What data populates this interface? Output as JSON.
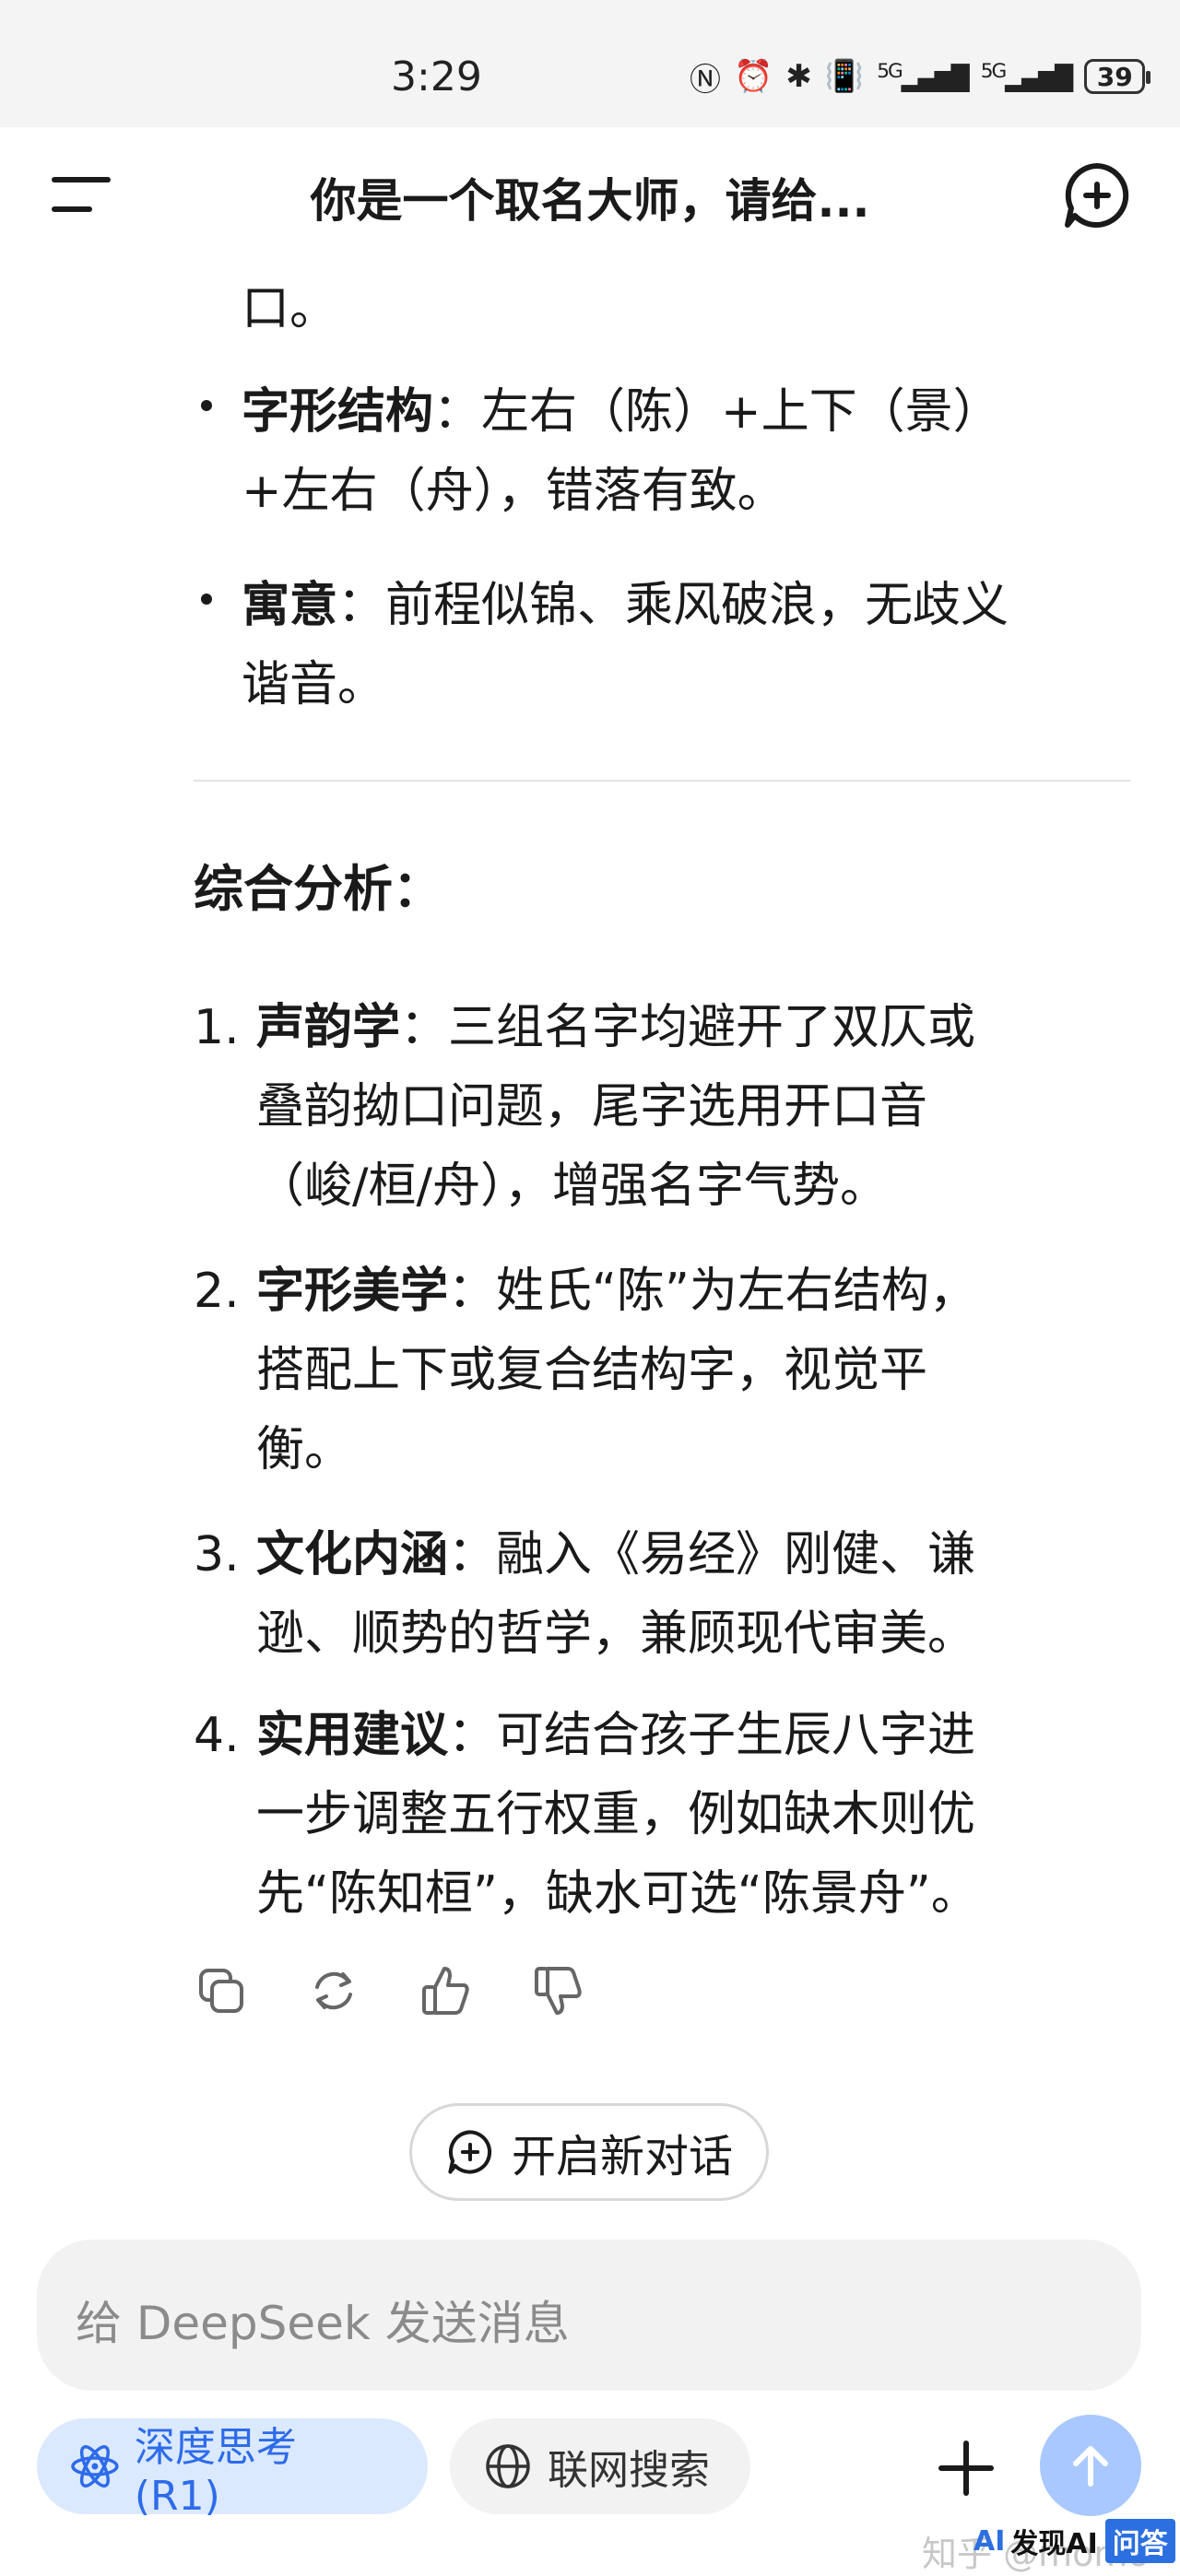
{
  "status_bar": {
    "time": "3:29",
    "network_1": "5G",
    "network_2": "5G",
    "battery": "39"
  },
  "header": {
    "title": "你是一个取名大师，请给..."
  },
  "message": {
    "continued_tail": "口。",
    "bullets": [
      {
        "label": "字形结构",
        "sep": "：",
        "line1": "左右（陈）+上下（景）",
        "line2": "+左右（舟），错落有致。"
      },
      {
        "label": "寓意",
        "sep": "：",
        "line1": "前程似锦、乘风破浪，无歧义",
        "line2": "谐音。"
      }
    ],
    "section_title": "综合分析：",
    "numbered": [
      {
        "num": "1.",
        "label": "声韵学",
        "sep": "：",
        "lines": [
          "三组名字均避开了双仄或",
          "叠韵拗口问题，尾字选用开口音",
          "（峻/桓/舟），增强名字气势。"
        ]
      },
      {
        "num": "2.",
        "label": "字形美学",
        "sep": "：",
        "lines": [
          "姓氏“陈”为左右结构，",
          "搭配上下或复合结构字，视觉平",
          "衡。"
        ]
      },
      {
        "num": "3.",
        "label": "文化内涵",
        "sep": "：",
        "lines": [
          "融入《易经》刚健、谦",
          "逊、顺势的哲学，兼顾现代审美。"
        ]
      },
      {
        "num": "4.",
        "label": "实用建议",
        "sep": "：",
        "lines": [
          "可结合孩子生辰八字进",
          "一步调整五行权重，例如缺木则优",
          "先“陈知桓”，缺水可选“陈景舟”。"
        ]
      }
    ]
  },
  "actions": {
    "copy": "copy-icon",
    "regenerate": "regenerate-icon",
    "like": "thumbs-up-icon",
    "dislike": "thumbs-down-icon"
  },
  "new_chat_button": "开启新对话",
  "composer": {
    "placeholder": "给 DeepSeek 发送消息"
  },
  "chips": {
    "deep_think": "深度思考 (R1)",
    "web_search": "联网搜索"
  },
  "watermark": "知乎 @momo",
  "brand": {
    "ai": "AI",
    "name": "发现AI",
    "tag": "问答"
  },
  "colors": {
    "accent": "#2d6bea",
    "chip_deep_bg": "#dbe9ff",
    "send_bg": "#a9c8ff"
  }
}
